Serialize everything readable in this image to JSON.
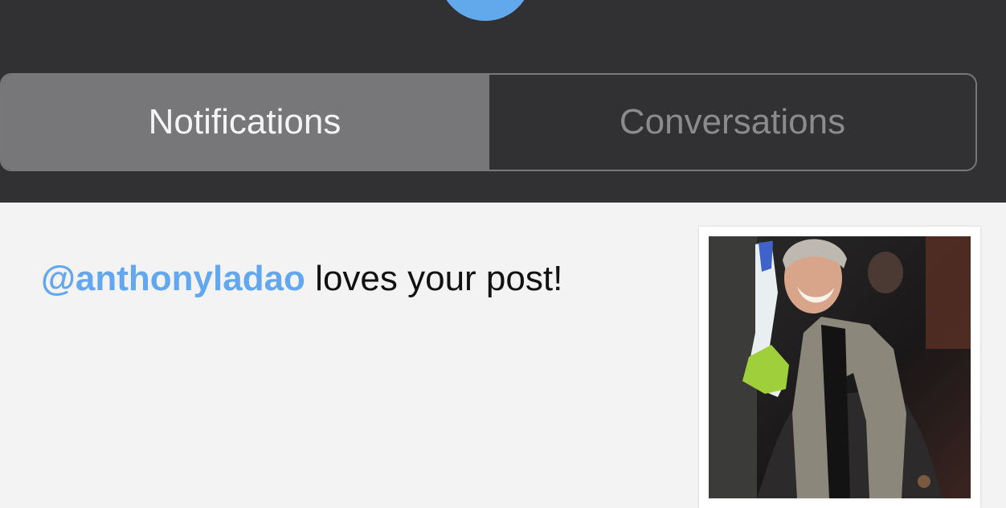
{
  "colors": {
    "header_bg": "#313033",
    "avatar_accent": "#62a9ec",
    "segment_active_bg": "#777779",
    "mention": "#63a8ee",
    "content_bg": "#f3f3f3"
  },
  "tabs": [
    {
      "label": "Notifications",
      "selected": true
    },
    {
      "label": "Conversations",
      "selected": false
    }
  ],
  "notification": {
    "mention": "@anthonyladao",
    "message": " loves your post!",
    "thumbnail_icon": "post-photo"
  }
}
